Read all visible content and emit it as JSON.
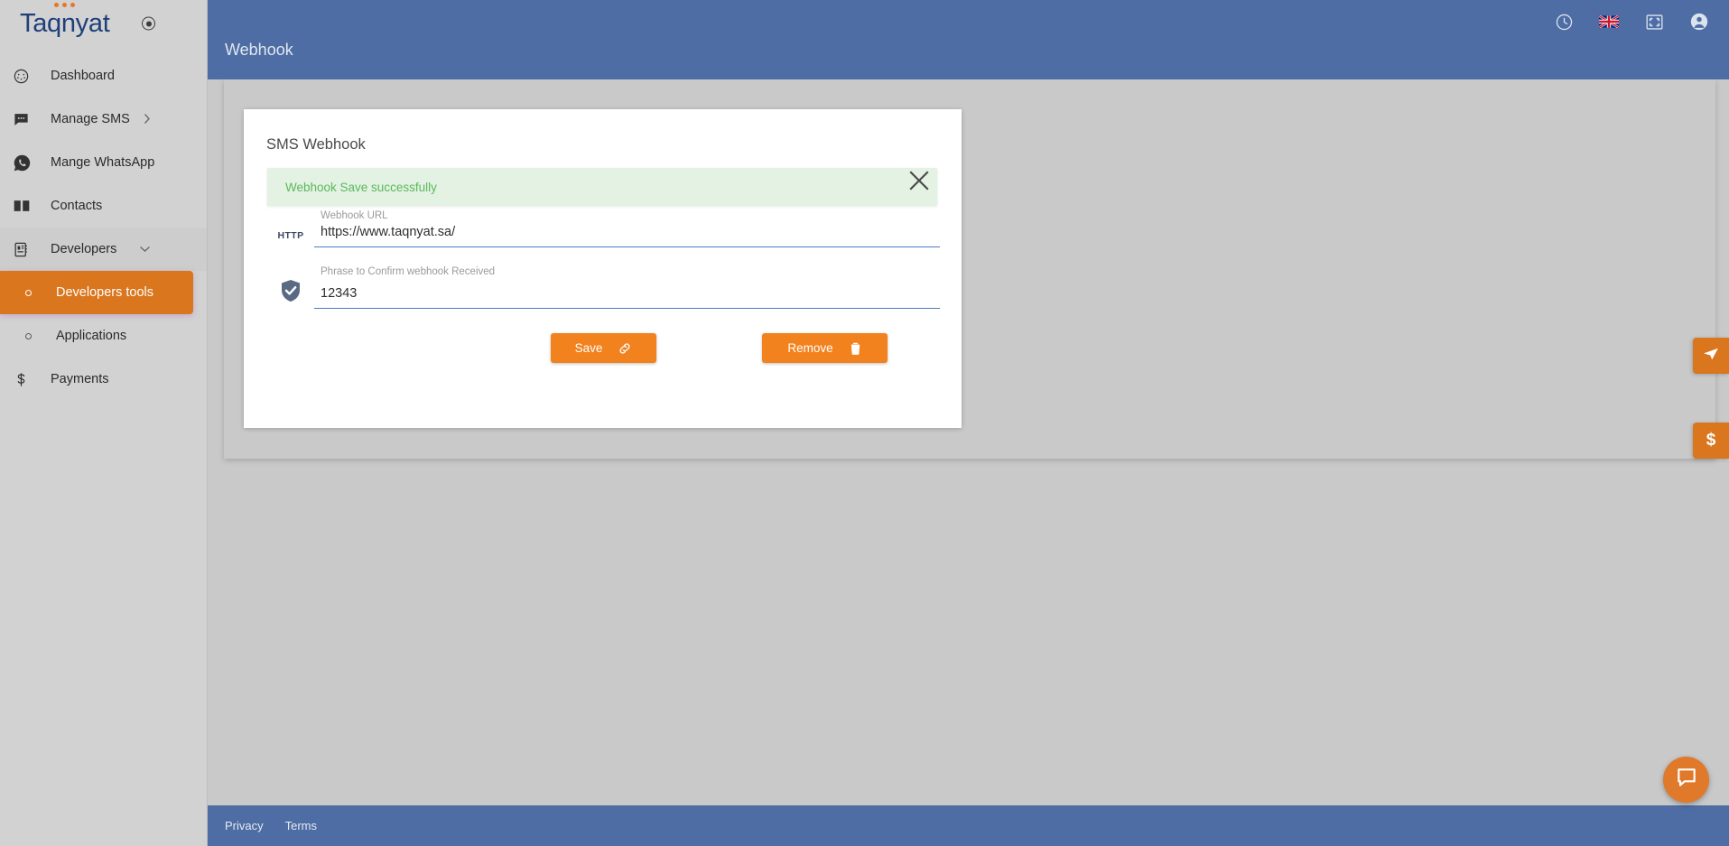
{
  "brand": {
    "name": "Taqnyat",
    "dot_color": "#e87722",
    "text_color": "#1f3f7a",
    "toggle_icon": "radio-dot-icon"
  },
  "sidebar": {
    "items": [
      {
        "label": "Dashboard",
        "icon": "dashboard-gauge-icon",
        "type": "item",
        "state": "default"
      },
      {
        "label": "Manage SMS",
        "icon": "chat-message-icon",
        "type": "item",
        "state": "default",
        "chevron": "chevron-right-icon"
      },
      {
        "label": "Mange WhatsApp",
        "icon": "whatsapp-icon",
        "type": "item",
        "state": "default"
      },
      {
        "label": "Contacts",
        "icon": "open-book-icon",
        "type": "item",
        "state": "default"
      },
      {
        "label": "Developers",
        "icon": "notebook-icon",
        "type": "section",
        "state": "expanded",
        "chevron": "chevron-down-icon"
      },
      {
        "label": "Developers tools",
        "icon": "bullet-circle-icon",
        "type": "sub",
        "state": "active"
      },
      {
        "label": "Applications",
        "icon": "bullet-circle-icon",
        "type": "sub",
        "state": "default"
      },
      {
        "label": "Payments",
        "icon": "dollar-sign-icon",
        "type": "item",
        "state": "default"
      }
    ],
    "active_bg": "#d9761e",
    "bg": "#d2d2d2"
  },
  "topbar": {
    "title": "Webhook",
    "bg": "#4d6da4",
    "icons": [
      {
        "name": "clock-icon",
        "glyph": "clock"
      },
      {
        "name": "uk-flag-icon",
        "glyph": "flag-uk"
      },
      {
        "name": "fullscreen-icon",
        "glyph": "fullscreen"
      },
      {
        "name": "user-avatar-icon",
        "glyph": "user"
      }
    ]
  },
  "card": {
    "title": "SMS Webhook",
    "alert": {
      "message": "Webhook Save successfully",
      "bg": "#e3f2e2",
      "text_color": "#5cb85c",
      "close_icon": "close-x-icon"
    },
    "fields": [
      {
        "label": "Webhook URL",
        "value": "https://www.taqnyat.sa/",
        "placeholder": "Webhook URL",
        "icon": "http-tag-icon",
        "icon_text": "HTTP",
        "underline_color": "#4d7cc0"
      },
      {
        "label": "Phrase to Confirm webhook Received",
        "value": "12343",
        "placeholder": "Phrase to Confirm webhook Received",
        "icon": "shield-check-icon",
        "icon_text": "",
        "underline_color": "#4d7cc0"
      }
    ],
    "buttons": [
      {
        "label": "Save",
        "icon": "link-chain-icon",
        "color": "#f2821e"
      },
      {
        "label": "Remove",
        "icon": "trash-bin-icon",
        "color": "#f2821e"
      }
    ]
  },
  "side_tabs": [
    {
      "name": "send-paper-plane-tab",
      "icon": "paper-plane-icon",
      "glyph": ""
    },
    {
      "name": "payments-tab",
      "icon": "dollar-sign-icon",
      "glyph": "$"
    }
  ],
  "chat": {
    "icon": "chat-bubble-icon",
    "bg": "#e0792a"
  },
  "footer": {
    "links": [
      {
        "label": "Privacy"
      },
      {
        "label": "Terms"
      }
    ]
  }
}
